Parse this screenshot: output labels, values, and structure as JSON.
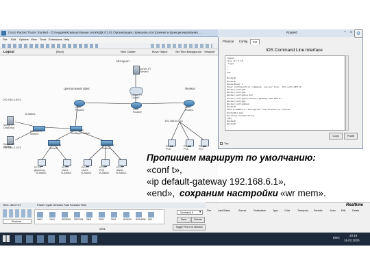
{
  "pt": {
    "title": "Cisco Packet Tracer Student - D:\\Андрей\\Компьютерные сети\\МДК.01.01 Организация, принципы построения и функционирования ...",
    "menu": [
      "File",
      "Edit",
      "Options",
      "View",
      "Tools",
      "Extensions",
      "Help"
    ],
    "nav": {
      "root": "[Root]",
      "cluster": "New Cluster",
      "move": "Move Object",
      "set_bg": "Set Tiled Background",
      "viewport": "Viewport"
    },
    "logical": "Logical",
    "realtime": "Realtime",
    "time": "Time: 46:07:37",
    "power": "Power Cycle Devices  Fast Forward Time",
    "routers_cat": "Routers",
    "models": [
      "1841",
      "1941",
      "2620XM",
      "2621XM",
      "2811",
      "2901",
      "2911",
      "819IOX",
      "819HGW",
      "829"
    ],
    "model_selected": "2901",
    "scenario": "Scenario 0",
    "new_btn": "New",
    "delete_btn": "Delete",
    "toggle_pdu": "Toggle PDU List Window",
    "event_cols": [
      "Fire",
      "Last Status",
      "Source",
      "Destination",
      "Type",
      "Color",
      "Time(sec)",
      "Periodic",
      "Num",
      "Edit",
      "Delete"
    ]
  },
  "topology": {
    "internet": "Интернет",
    "server_web": "Server-PT\nServer0",
    "cloud": "Cloud-PT\nCloud0",
    "router2": "2911\nRouter2",
    "central": "Центральный офис",
    "branch": "Филиал",
    "router0": "2901\nRouter0",
    "router1": "2901\nRouter1",
    "net1": "192.168.4.0/24",
    "net2": "192.168.6.0/24",
    "net3": "192.168.4.1/24",
    "net4": "192.168.5.0/24",
    "vlan803": "VLAN803",
    "switch1": "2950-24TT\nSwitch1",
    "mls": "3560-24PS\nMultilayer Switch",
    "switch0": "2960-24TT\nSwitch0",
    "switch2": "2960-24TT\nSwitch2",
    "srv_dns": "Server-PT\nDns/Dhcp",
    "srv_ftp": "Server-PT\nhttp/ftp",
    "pcs": [
      {
        "name": "PC-PT\nДиректор",
        "vlan": "VLAN802"
      },
      {
        "name": "PC-PT\nUser1",
        "vlan": "VLAN802"
      },
      {
        "name": "PC-PT\nUser2",
        "vlan": "VLAN802"
      },
      {
        "name": "PC-PT\nPC5",
        "vlan": "VLAN802"
      },
      {
        "name": "PC-PT\nAdmin",
        "vlan": "VLAN802"
      }
    ],
    "pcs_branch": [
      "PC-PT\nPC6",
      "PC-PT\nPC6",
      "PC-PT\nPC7"
    ]
  },
  "cli": {
    "window_title": "Router0",
    "tabs": [
      "Physical",
      "Config",
      "CLI"
    ],
    "active_tab": "CLI",
    "header": "IOS Command Line Interface",
    "lines": [
      "logout",
      "line vty 0 15",
      " login",
      "!",
      "!",
      "end",
      "",
      "Router#",
      "Router#",
      "Router#conf t",
      "Enter configuration commands, one per line.  End with CNTL/Z.",
      "Router(config)#",
      "Router(config)#",
      "Router(config)#ip def",
      "Router(config)#ip default-gateway 192.168.6.1",
      "Router(config)#",
      "Router(config)#end",
      "Router#",
      "%SYS-5-CONFIG_I: Configured from console by console",
      "Router#wr mem",
      "Building configuration...",
      "[OK]",
      "Router#",
      "Router#"
    ],
    "copy": "Copy",
    "paste": "Paste",
    "top_checkbox": "Top"
  },
  "overlay": {
    "heading": "Пропишем маршрут по умолчанию:",
    "line1": "«conf t»,",
    "line2": "«ip default-gateway 192.168.6.1»,",
    "line3_a": "«end»,",
    "line3_b": "сохраним настройки",
    "line3_c": "«wr mem»."
  },
  "taskbar": {
    "lang": "ENG",
    "time": "20:19",
    "date": "16.02.2020"
  },
  "colors": {
    "accent": "#2f5b86",
    "cli_bg": "#ffffff",
    "taskbar": "#1c2a3b"
  }
}
